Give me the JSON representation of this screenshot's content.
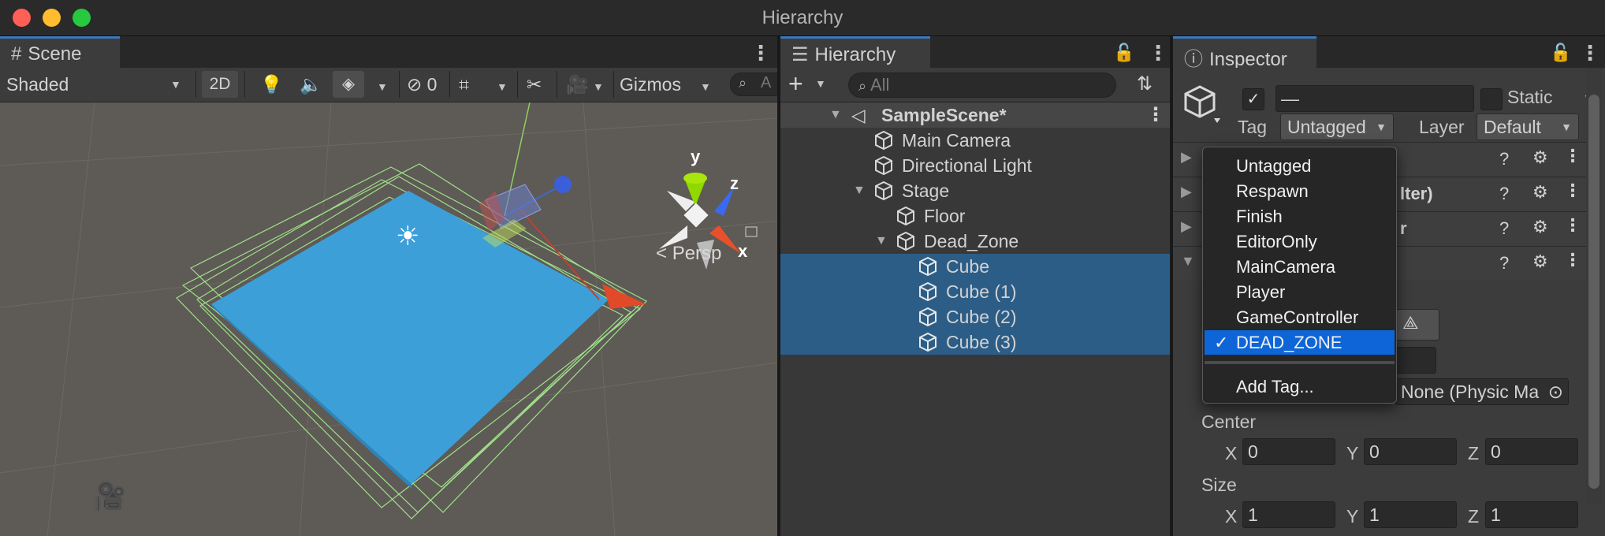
{
  "window": {
    "title": "Hierarchy"
  },
  "scene": {
    "tab_label": "Scene",
    "toolbar": {
      "shading": "Shaded",
      "mode_2d": "2D",
      "hidden_count": "0",
      "gizmos": "Gizmos",
      "search_placeholder": "A"
    },
    "view": {
      "projection_label": "Persp",
      "axis_x": "x",
      "axis_y": "y",
      "axis_z": "z"
    }
  },
  "hierarchy": {
    "tab_label": "Hierarchy",
    "search_placeholder": "All",
    "rows": [
      {
        "label": "SampleScene*"
      },
      {
        "label": "Main Camera"
      },
      {
        "label": "Directional Light"
      },
      {
        "label": "Stage"
      },
      {
        "label": "Floor"
      },
      {
        "label": "Dead_Zone"
      },
      {
        "label": "Cube"
      },
      {
        "label": "Cube (1)"
      },
      {
        "label": "Cube (2)"
      },
      {
        "label": "Cube (3)"
      }
    ]
  },
  "inspector": {
    "tab_label": "Inspector",
    "name_field": "—",
    "static_label": "Static",
    "tag_label": "Tag",
    "tag_value": "Untagged",
    "layer_label": "Layer",
    "layer_value": "Default",
    "component_fragments": [
      "lter)",
      "r"
    ],
    "material_value": "None (Physic Ma",
    "center_label": "Center",
    "size_label": "Size",
    "axis_x": "X",
    "axis_y": "Y",
    "axis_z": "Z",
    "center": {
      "x": "0",
      "y": "0",
      "z": "0"
    },
    "size": {
      "x": "1",
      "y": "1",
      "z": "1"
    }
  },
  "tag_menu": {
    "items": [
      "Untagged",
      "Respawn",
      "Finish",
      "EditorOnly",
      "MainCamera",
      "Player",
      "GameController",
      "DEAD_ZONE"
    ],
    "selected": "DEAD_ZONE",
    "check_mark": "✓",
    "add_tag": "Add Tag..."
  },
  "colors": {
    "accent": "#3a79bb",
    "selection": "#2c5d87",
    "menu_highlight": "#0d65d8",
    "floor_blue": "#3d9fd8",
    "viewport_bg": "#5e5a55"
  }
}
